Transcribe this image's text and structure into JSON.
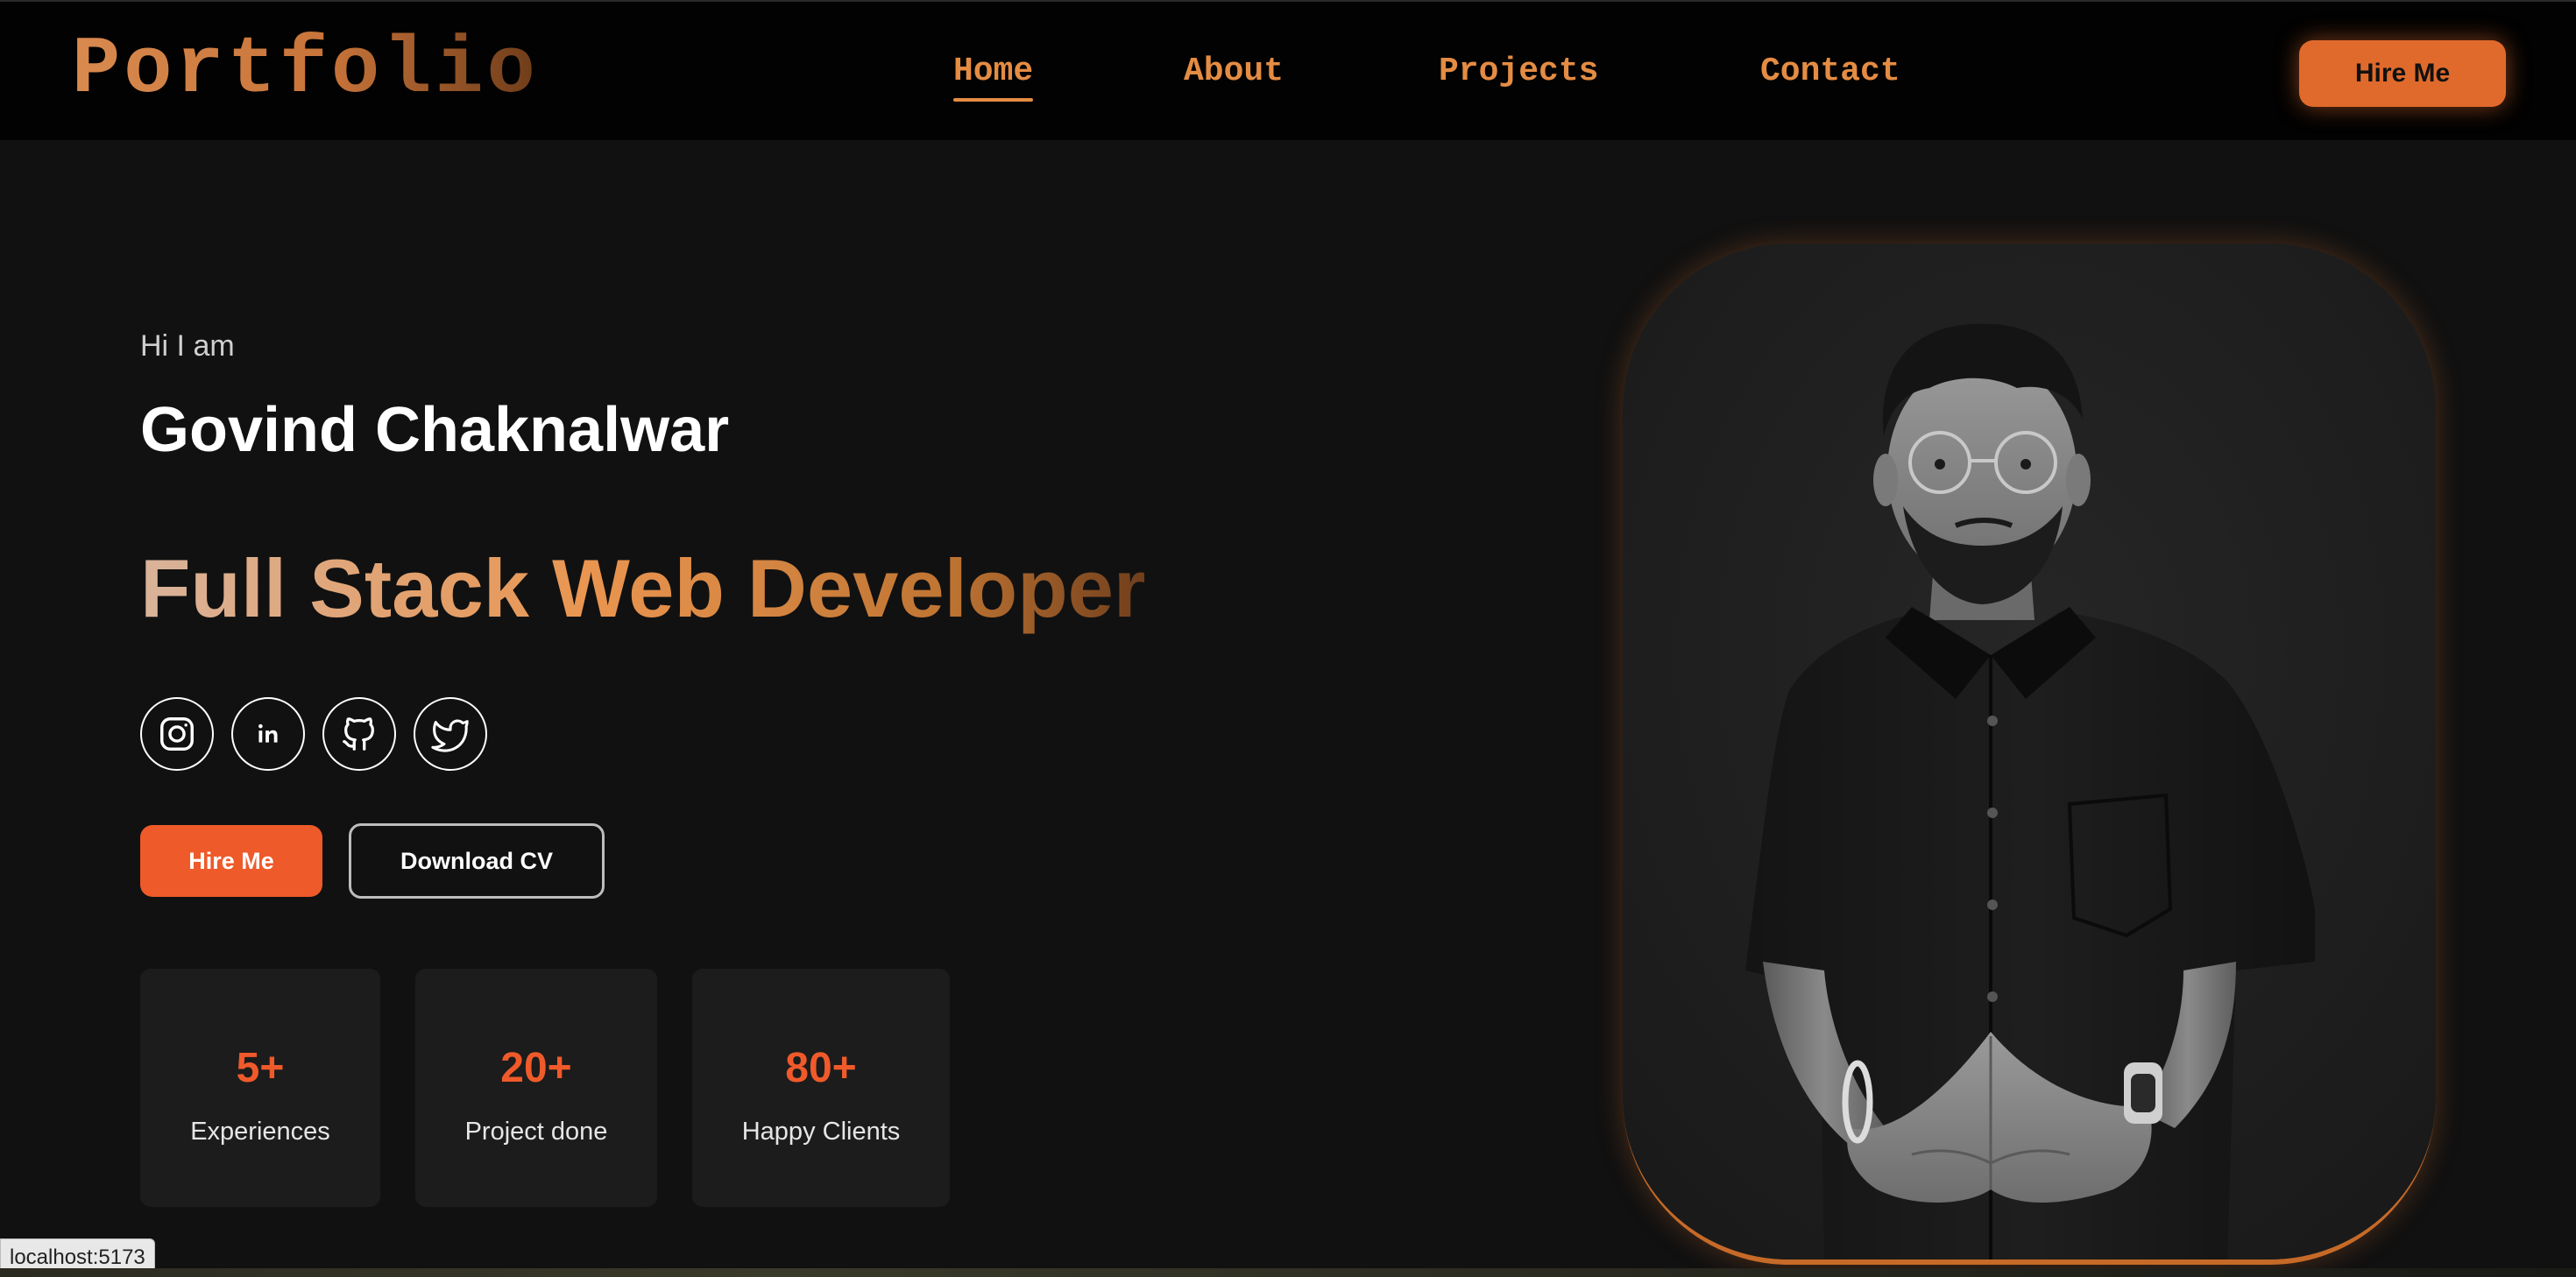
{
  "nav": {
    "logo": "Portfolio",
    "links": [
      {
        "label": "Home",
        "active": true
      },
      {
        "label": "About",
        "active": false
      },
      {
        "label": "Projects",
        "active": false
      },
      {
        "label": "Contact",
        "active": false
      }
    ],
    "hire_label": "Hire Me"
  },
  "hero": {
    "greeting": "Hi I am",
    "name": "Govind Chaknalwar",
    "role": "Full Stack Web Developer",
    "socials": [
      {
        "icon": "instagram-icon"
      },
      {
        "icon": "linkedin-icon"
      },
      {
        "icon": "github-icon"
      },
      {
        "icon": "twitter-icon"
      }
    ],
    "hire_label": "Hire Me",
    "cv_label": "Download CV",
    "stats": [
      {
        "value": "5+",
        "label": "Experiences"
      },
      {
        "value": "20+",
        "label": "Project done"
      },
      {
        "value": "80+",
        "label": "Happy Clients"
      }
    ]
  },
  "status": {
    "url": "localhost:5173"
  },
  "colors": {
    "accent": "#e48c43",
    "orange_button": "#ee5a29",
    "background": "#111111",
    "nav_background": "#020202"
  }
}
